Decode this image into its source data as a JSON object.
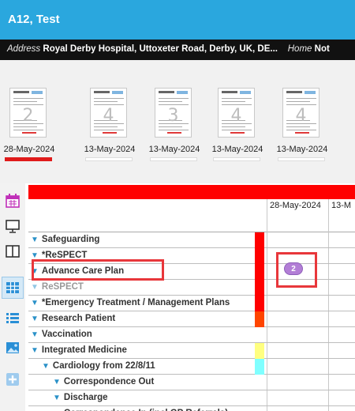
{
  "patient": {
    "title": "A12, Test"
  },
  "address_bar": {
    "address_label": "Address",
    "address_value": "Royal Derby Hospital, Uttoxeter Road, Derby, UK, DE...",
    "home_label": "Home",
    "home_value": "Not"
  },
  "thumbnails": [
    {
      "date": "28-May-2024",
      "count": "2",
      "selected": true
    },
    {
      "date": "13-May-2024",
      "count": "4",
      "selected": false
    },
    {
      "date": "13-May-2024",
      "count": "3",
      "selected": false
    },
    {
      "date": "13-May-2024",
      "count": "4",
      "selected": false
    },
    {
      "date": "13-May-2024",
      "count": "4",
      "selected": false
    }
  ],
  "rail": {
    "icons": [
      "calendar-icon",
      "monitor-icon",
      "split-view-icon",
      "grid-view-icon",
      "list-view-icon",
      "image-icon",
      "add-icon"
    ]
  },
  "grid": {
    "columns": [
      "28-May-2024",
      "13-M"
    ],
    "rows": [
      {
        "label": "Safeguarding",
        "indent": 0,
        "color": "#ff0000",
        "prefix": ""
      },
      {
        "label": "*ReSPECT",
        "indent": 0,
        "color": "#ff0000",
        "prefix": ""
      },
      {
        "label": "Advance Care Plan",
        "indent": 0,
        "color": "#ff0000",
        "prefix": ""
      },
      {
        "label": "ReSPECT",
        "indent": 0,
        "color": "#ff0000",
        "prefix": ""
      },
      {
        "label": "*Emergency Treatment / Management Plans",
        "indent": 0,
        "color": "#ff0000",
        "prefix": ""
      },
      {
        "label": "Research Patient",
        "indent": 0,
        "color": "#ff4500",
        "prefix": ""
      },
      {
        "label": "Vaccination",
        "indent": 0,
        "color": "",
        "prefix": ""
      },
      {
        "label": "Integrated Medicine",
        "indent": 0,
        "color": "#ffff80",
        "prefix": ""
      },
      {
        "label": "Cardiology from 22/8/11",
        "indent": 1,
        "color": "#80ffff",
        "prefix": ""
      },
      {
        "label": "Correspondence Out",
        "indent": 2,
        "color": "",
        "prefix": ""
      },
      {
        "label": "Discharge",
        "indent": 2,
        "color": "",
        "prefix": ""
      },
      {
        "label": "Correspondence In (incl GP Referrals)",
        "indent": 2,
        "color": "",
        "prefix": ""
      }
    ],
    "badge_value": "2"
  }
}
